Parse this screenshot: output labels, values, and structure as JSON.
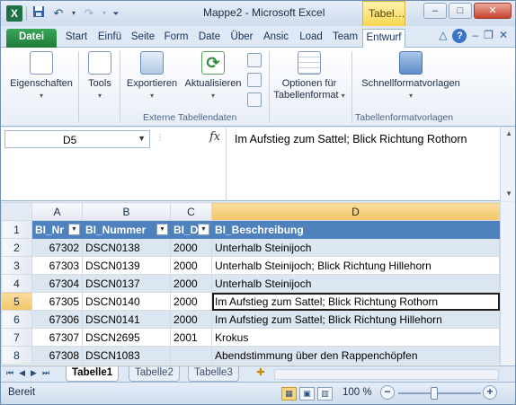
{
  "titlebar": {
    "app_title": "Mappe2 - Microsoft Excel",
    "contextual_title": "Tabel…",
    "qat": {
      "save_icon": "save-icon",
      "undo_icon": "undo-icon",
      "redo_icon": "redo-icon"
    },
    "controls": {
      "minimize": "–",
      "maximize": "□",
      "close": "✕"
    }
  },
  "tabs": [
    {
      "label": "Datei"
    },
    {
      "label": "Start"
    },
    {
      "label": "Einfü"
    },
    {
      "label": "Seite"
    },
    {
      "label": "Form"
    },
    {
      "label": "Date"
    },
    {
      "label": "Über"
    },
    {
      "label": "Ansic"
    },
    {
      "label": "Load"
    },
    {
      "label": "Team"
    },
    {
      "label": "Entwurf"
    }
  ],
  "ribbon": {
    "properties_label": "Eigenschaften",
    "tools_label": "Tools",
    "export_label": "Exportieren",
    "refresh_label": "Aktualisieren",
    "options_label_1": "Optionen für",
    "options_label_2": "Tabellenformat",
    "styles_label": "Schnellformatvorlagen",
    "group_external": "Externe Tabellendaten",
    "group_styles": "Tabellenformatvorlagen"
  },
  "formula": {
    "name_box": "D5",
    "fx": "fx",
    "content": "Im Aufstieg zum Sattel; Blick Richtung Rothorn"
  },
  "grid": {
    "columns": [
      "A",
      "B",
      "C",
      "D"
    ],
    "headers": [
      "BI_Nr",
      "BI_Nummer",
      "BI_D",
      "BI_Beschreibung"
    ],
    "rows": [
      {
        "num": "2",
        "nr": "67302",
        "nummer": "DSCN0138",
        "d": "2000",
        "desc": "Unterhalb Steinijoch"
      },
      {
        "num": "3",
        "nr": "67303",
        "nummer": "DSCN0139",
        "d": "2000",
        "desc": "Unterhalb Steinijoch; Blick Richtung Hillehorn"
      },
      {
        "num": "4",
        "nr": "67304",
        "nummer": "DSCN0137",
        "d": "2000",
        "desc": "Unterhalb Steinijoch"
      },
      {
        "num": "5",
        "nr": "67305",
        "nummer": "DSCN0140",
        "d": "2000",
        "desc": "Im Aufstieg zum Sattel; Blick Richtung Rothorn"
      },
      {
        "num": "6",
        "nr": "67306",
        "nummer": "DSCN0141",
        "d": "2000",
        "desc": "Im Aufstieg zum Sattel; Blick Richtung Hillehorn"
      },
      {
        "num": "7",
        "nr": "67307",
        "nummer": "DSCN2695",
        "d": "2001",
        "desc": "Krokus"
      },
      {
        "num": "8",
        "nr": "67308",
        "nummer": "DSCN1083",
        "d": "",
        "desc": "Abendstimmung über den Rappenchöpfen"
      }
    ]
  },
  "sheets": [
    {
      "label": "Tabelle1"
    },
    {
      "label": "Tabelle2"
    },
    {
      "label": "Tabelle3"
    }
  ],
  "status": {
    "ready": "Bereit",
    "zoom": "100 %"
  }
}
